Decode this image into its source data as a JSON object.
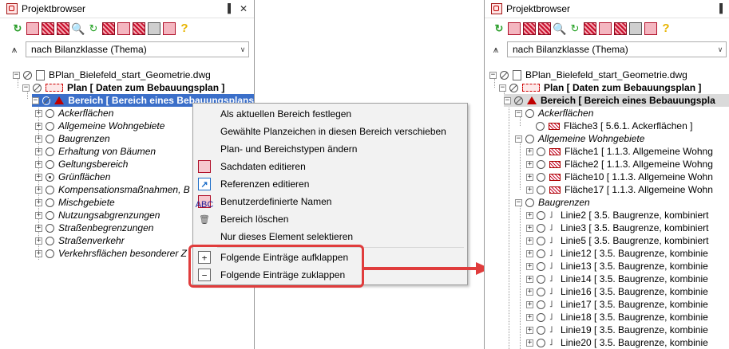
{
  "left_panel": {
    "title": "Projektbrowser",
    "pin": "▐",
    "close": "✕",
    "filter_value": "nach Bilanzklasse (Thema)",
    "tree": {
      "file": "BPlan_Bielefeld_start_Geometrie.dwg",
      "plan": "Plan [ Daten zum Bebauungsplan ]",
      "bereich": "Bereich [ Bereich eines Bebauungsplans",
      "items": [
        "Ackerflächen",
        "Allgemeine Wohngebiete",
        "Baugrenzen",
        "Erhaltung von Bäumen",
        "Geltungsbereich",
        "Grünflächen",
        "Kompensationsmaßnahmen, B",
        "Mischgebiete",
        "Nutzungsabgrenzungen",
        "Straßenbegrenzungen",
        "Straßenverkehr",
        "Verkehrsflächen besonderer Z"
      ]
    }
  },
  "context_menu": {
    "items": [
      {
        "label": "Als aktuellen Bereich festlegen",
        "icon": ""
      },
      {
        "label": "Gewählte Planzeichen in diesen Bereich verschieben",
        "icon": ""
      },
      {
        "label": "Plan- und Bereichstypen ändern",
        "icon": ""
      },
      {
        "label": "Sachdaten editieren",
        "icon": "sachdaten-icon"
      },
      {
        "label": "Referenzen editieren",
        "icon": "referenzen-icon"
      },
      {
        "label": "Benutzerdefinierte Namen",
        "icon": "benutzernamen-icon"
      },
      {
        "label": "Bereich löschen",
        "icon": "trash-icon"
      },
      {
        "label": "Nur dieses Element selektieren",
        "icon": ""
      },
      {
        "label": "Folgende Einträge aufklappen",
        "icon": "plus-box-icon"
      },
      {
        "label": "Folgende Einträge zuklappen",
        "icon": "minus-box-icon"
      }
    ],
    "ref_glyph": "↗",
    "names_glyph": "ABC",
    "trash_glyph": "🗑",
    "plus_glyph": "+",
    "minus_glyph": "−"
  },
  "right_panel": {
    "title": "Projektbrowser",
    "pin": "▐",
    "filter_value": "nach Bilanzklasse (Thema)",
    "tree": {
      "file": "BPlan_Bielefeld_start_Geometrie.dwg",
      "plan": "Plan [ Daten zum Bebauungsplan ]",
      "bereich": "Bereich [ Bereich eines Bebauungspla",
      "group_ackerflaechen": "Ackerflächen",
      "flaeche3": "Fläche3 [ 5.6.1. Ackerflächen ]",
      "group_wohngebiete": "Allgemeine Wohngebiete",
      "wohn_items": [
        "Fläche1 [ 1.1.3. Allgemeine Wohng",
        "Fläche2 [ 1.1.3. Allgemeine Wohng",
        "Fläche10 [ 1.1.3. Allgemeine Wohn",
        "Fläche17 [ 1.1.3. Allgemeine Wohn"
      ],
      "group_baugrenzen": "Baugrenzen",
      "linie_items": [
        "Linie2 [ 3.5. Baugrenze, kombiniert",
        "Linie3 [ 3.5. Baugrenze, kombiniert",
        "Linie5 [ 3.5. Baugrenze, kombiniert",
        "Linie12 [ 3.5. Baugrenze, kombinie",
        "Linie13 [ 3.5. Baugrenze, kombinie",
        "Linie14 [ 3.5. Baugrenze, kombinie",
        "Linie16 [ 3.5. Baugrenze, kombinie",
        "Linie17 [ 3.5. Baugrenze, kombinie",
        "Linie18 [ 3.5. Baugrenze, kombinie",
        "Linie19 [ 3.5. Baugrenze, kombinie",
        "Linie20 [ 3.5. Baugrenze, kombinie"
      ]
    }
  },
  "glyphs": {
    "expand": "+",
    "collapse": "−",
    "combo_arrow": "∨",
    "filter": "⩚",
    "refresh": "↻",
    "magnifier": "🔍",
    "help": "?",
    "line": "˩"
  },
  "colors": {
    "selection": "#3b6fc9",
    "highlight": "#e03c3c",
    "accent_red": "#c8102e"
  }
}
